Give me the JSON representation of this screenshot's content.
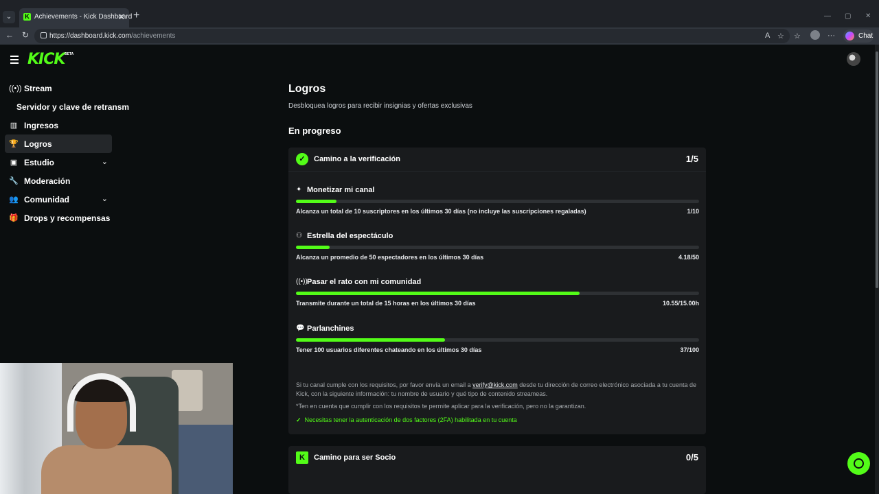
{
  "browser": {
    "tab_title": "Achievements - Kick Dashboard",
    "tab_favicon": "K",
    "tab_close": "✕",
    "new_tab": "+",
    "url_host": "https://dashboard.kick.com",
    "url_path": "/achievements",
    "chat_label": "Chat"
  },
  "header": {
    "logo": "KICK",
    "beta": "BETA"
  },
  "sidebar": {
    "items": [
      {
        "label": "Stream",
        "icon": "broadcast-icon",
        "glyph": "((•))"
      },
      {
        "label": "Servidor y clave de retransm",
        "icon": "",
        "glyph": ""
      },
      {
        "label": "Ingresos",
        "icon": "chart-icon",
        "glyph": "▥"
      },
      {
        "label": "Logros",
        "icon": "trophy-icon",
        "glyph": "🏆"
      },
      {
        "label": "Estudio",
        "icon": "studio-icon",
        "glyph": "▣"
      },
      {
        "label": "Moderación",
        "icon": "wrench-icon",
        "glyph": "🔧"
      },
      {
        "label": "Comunidad",
        "icon": "users-icon",
        "glyph": "👥"
      },
      {
        "label": "Drops y recompensas",
        "icon": "gift-icon",
        "glyph": "🎁"
      }
    ]
  },
  "main": {
    "title": "Logros",
    "subtitle": "Desbloquea logros para recibir insignias y ofertas exclusivas",
    "section": "En progreso",
    "verification_card": {
      "title": "Camino a la verificación",
      "count": "1/5",
      "achievements": [
        {
          "title": "Monetizar mi canal",
          "glyph": "✦",
          "desc": "Alcanza un total de 10 suscriptores en los últimos 30 días (no incluye las suscripciones regaladas)",
          "value": "1/10",
          "progress": 0.1
        },
        {
          "title": "Estrella del espectáculo",
          "glyph": "⚇",
          "desc": "Alcanza un promedio de 50 espectadores en los últimos 30 días",
          "value": "4.18/50",
          "progress": 0.0836
        },
        {
          "title": "Pasar el rato con mi comunidad",
          "glyph": "((•))",
          "desc": "Transmite durante un total de 15 horas en los últimos 30 días",
          "value": "10.55/15.00h",
          "progress": 0.7033
        },
        {
          "title": "Parlanchines",
          "glyph": "💬",
          "desc": "Tener 100 usuarios diferentes chateando en los últimos 30 días",
          "value": "37/100",
          "progress": 0.37
        }
      ],
      "note_before": "Si tu canal cumple con los requisitos, por favor envía un email a ",
      "note_link": "verify@kick.com",
      "note_after": " desde tu dirección de correo electrónico asociada a tu cuenta de Kick, con la siguiente información: tu nombre de usuario y qué tipo de contenido streameas.",
      "note2": "*Ten en cuenta que cumplir con los requisitos te permite aplicar para la verificación, pero no la garantizan.",
      "requirement": "Necesitas tener la autenticación de dos factores (2FA) habilitada en tu cuenta"
    },
    "partner_card": {
      "title": "Camino para ser Socio",
      "count": "0/5"
    }
  },
  "colors": {
    "accent": "#53fc18",
    "card_bg": "#191b1d",
    "page_bg": "#0b0e0f"
  }
}
